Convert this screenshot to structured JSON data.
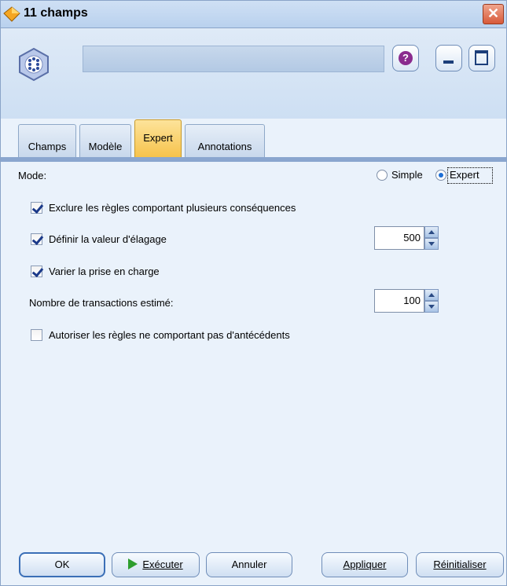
{
  "window": {
    "title": "11 champs",
    "close_glyph": "✕"
  },
  "header": {
    "name_value": "",
    "help_glyph": "?"
  },
  "tabs": [
    {
      "label": "Champs",
      "active": false
    },
    {
      "label": "Modèle",
      "active": false
    },
    {
      "label": "Expert",
      "active": true
    },
    {
      "label": "Annotations",
      "active": false
    }
  ],
  "content": {
    "mode_label": "Mode:",
    "mode_options": [
      {
        "label": "Simple",
        "selected": false
      },
      {
        "label": "Expert",
        "selected": true
      }
    ],
    "exclude_rules": {
      "label": "Exclure les règles comportant plusieurs conséquences",
      "checked": true
    },
    "pruning": {
      "label": "Définir la valeur d'élagage",
      "checked": true,
      "value": "500"
    },
    "vary_support": {
      "label": "Varier la prise en charge",
      "checked": true
    },
    "transactions": {
      "label": "Nombre de transactions estimé:",
      "value": "100"
    },
    "allow_rules": {
      "label": "Autoriser les règles ne comportant pas d'antécédents",
      "checked": false
    }
  },
  "footer": {
    "ok_label": "OK",
    "run_label": "Exécuter",
    "cancel_label": "Annuler",
    "apply_label": "Appliquer",
    "reset_label": "Réinitialiser"
  },
  "icons": {
    "title": "node-diamond-icon",
    "node": "association-model-icon",
    "help": "help-icon",
    "minimize": "minimize-icon",
    "maximize": "maximize-icon",
    "close": "close-icon",
    "run": "play-icon"
  },
  "colors": {
    "active_tab": "#f6c24a",
    "accent": "#3b6fb7",
    "window_bg": "#eaf2fb"
  }
}
